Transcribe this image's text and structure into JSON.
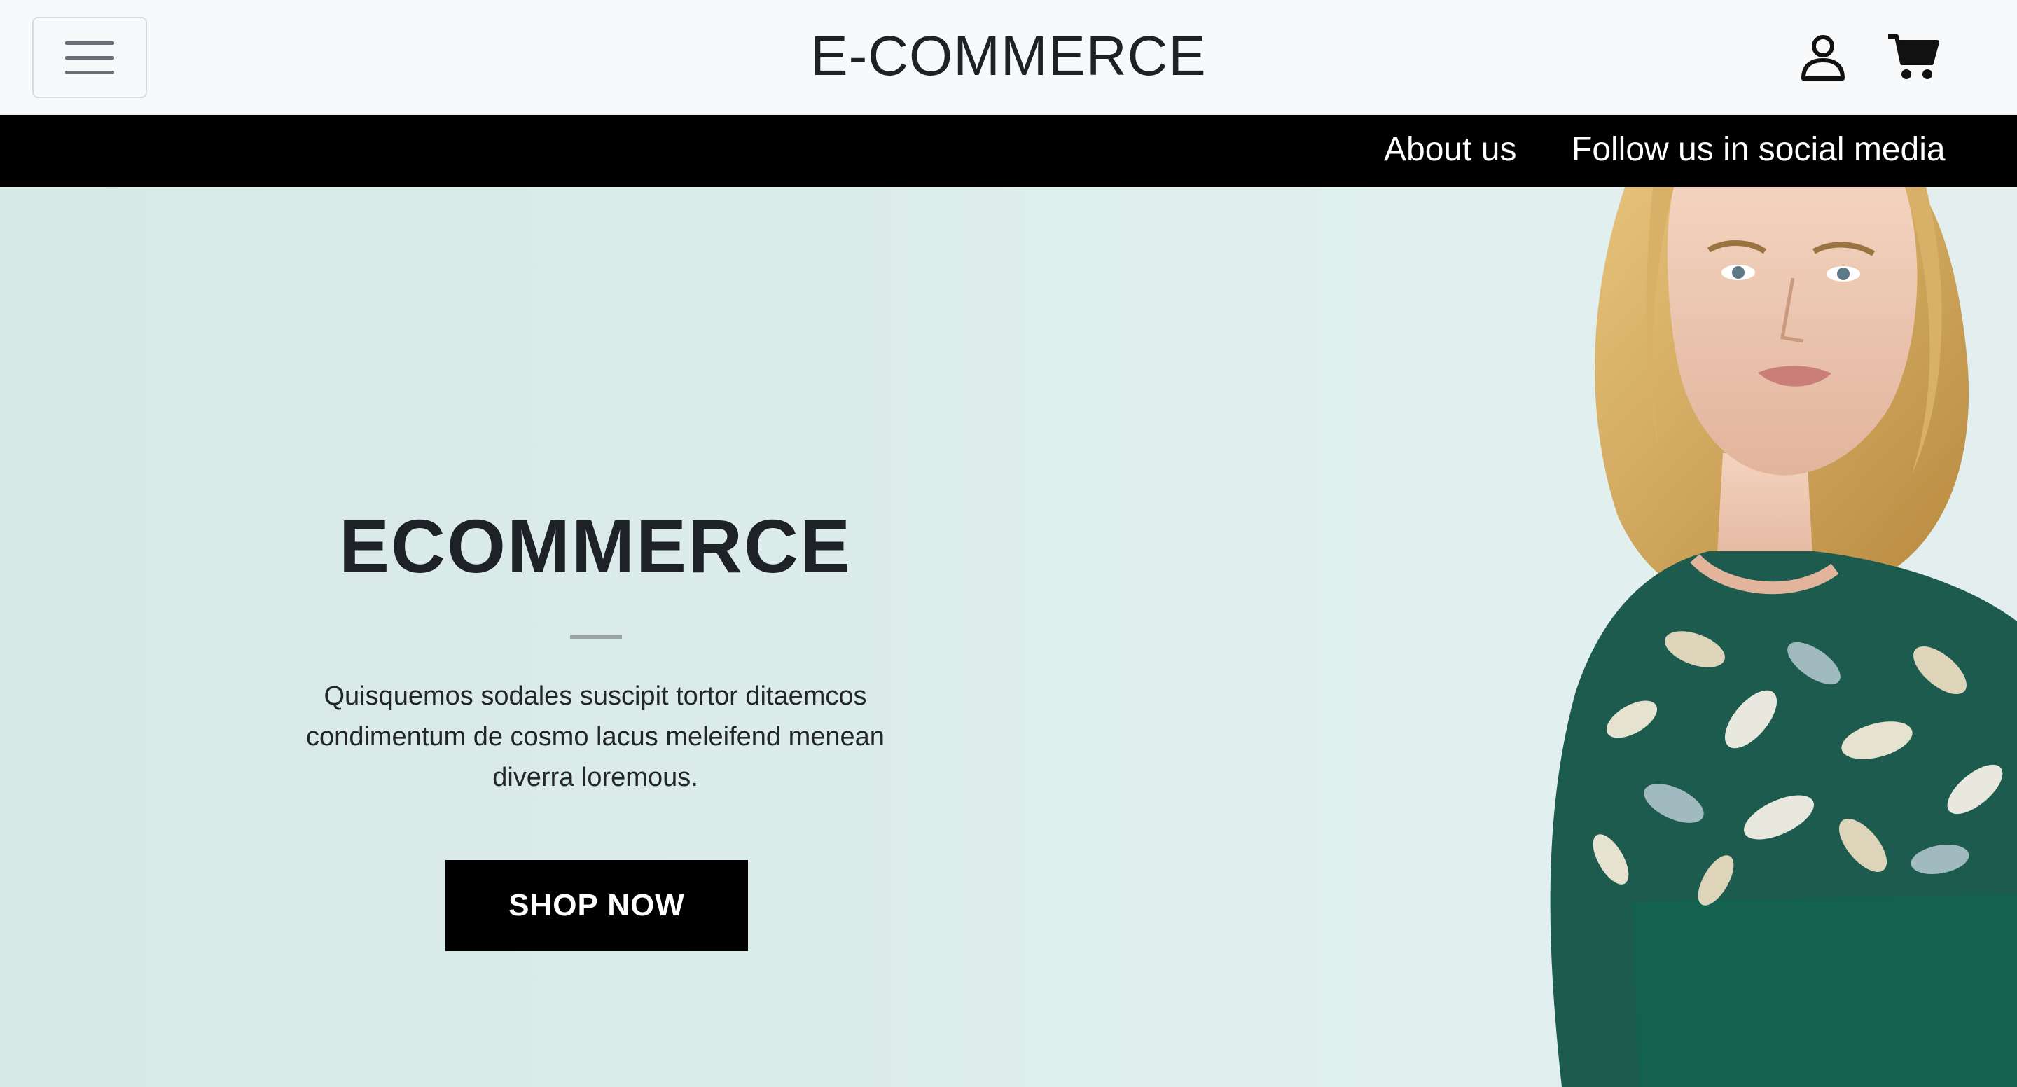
{
  "header": {
    "brand": "E-COMMERCE",
    "menu_icon": "hamburger-menu-icon",
    "user_icon": "user-icon",
    "cart_icon": "shopping-cart-icon"
  },
  "navbar": {
    "links": [
      "About us",
      "Follow us in social media"
    ]
  },
  "hero": {
    "title": "ECOMMERCE",
    "description": "Quisquemos sodales suscipit tortor ditaemcos condimentum de cosmo lacus meleifend menean diverra loremous.",
    "cta_label": "SHOP NOW",
    "image": "woman-in-floral-green-top-photo"
  },
  "colors": {
    "header_bg": "#f8f9fb",
    "navbar_bg": "#000000",
    "hero_bg": "#dcecea",
    "button_bg": "#000000",
    "text_dark": "#1f2124"
  }
}
